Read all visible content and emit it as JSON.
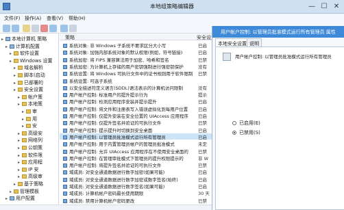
{
  "window": {
    "title": "本地组策略编辑器",
    "minimize": "—",
    "maximize": "☐",
    "close": "✕"
  },
  "menu": [
    {
      "label": "文件(F)"
    },
    {
      "label": "操作(A)"
    },
    {
      "label": "查看(V)"
    },
    {
      "label": "帮助(H)"
    }
  ],
  "tree": [
    {
      "label": "本地计算机 策略",
      "indent": 0,
      "icon": "computer-icon"
    },
    {
      "label": "计算机配置",
      "indent": 1,
      "icon": "computer-icon"
    },
    {
      "label": "软件设置",
      "indent": 2,
      "icon": "folder-icon"
    },
    {
      "label": "Windows 设置",
      "indent": 2,
      "icon": "folder-icon"
    },
    {
      "label": "域名解析",
      "indent": 3,
      "icon": "folder-icon"
    },
    {
      "label": "脚本(启动",
      "indent": 3,
      "icon": "folder-icon"
    },
    {
      "label": "已部署的",
      "indent": 3,
      "icon": "folder-icon"
    },
    {
      "label": "安全设置",
      "indent": 3,
      "icon": "folder-icon"
    },
    {
      "label": "帐户策",
      "indent": 4,
      "icon": "folder-icon"
    },
    {
      "label": "本地策",
      "indent": 4,
      "icon": "folder-icon"
    },
    {
      "label": "审",
      "indent": 5,
      "icon": "folder-icon"
    },
    {
      "label": "用",
      "indent": 5,
      "icon": "folder-icon"
    },
    {
      "label": "安",
      "indent": 5,
      "icon": "folder-icon"
    },
    {
      "label": "高级安",
      "indent": 4,
      "icon": "folder-icon"
    },
    {
      "label": "网络列",
      "indent": 4,
      "icon": "folder-icon"
    },
    {
      "label": "公钥策",
      "indent": 4,
      "icon": "folder-icon"
    },
    {
      "label": "软件限",
      "indent": 4,
      "icon": "folder-icon"
    },
    {
      "label": "应用程",
      "indent": 4,
      "icon": "folder-icon"
    },
    {
      "label": "IP 安",
      "indent": 4,
      "icon": "folder-icon"
    },
    {
      "label": "高级审",
      "indent": 4,
      "icon": "folder-icon"
    },
    {
      "label": "基于策略",
      "indent": 3,
      "icon": "folder-icon"
    },
    {
      "label": "管理模板",
      "indent": 2,
      "icon": "folder-icon"
    },
    {
      "label": "用户配置",
      "indent": 1,
      "icon": "user-icon"
    }
  ],
  "list": {
    "headers": {
      "policy": "策略",
      "setting": "安全设置"
    },
    "rows": [
      {
        "name": "系统对象: 非 Windows 子系统不要求区分大小写",
        "state": "已启"
      },
      {
        "name": "系统对象: 加强内部系统对象的默认权限(例如，符号链接)",
        "state": "已启"
      },
      {
        "name": "系统加密: 将 FIPS 兼容算法用于加密、哈希和签名",
        "state": "已禁"
      },
      {
        "name": "系统加密: 为计算机上存储的用户密钥强制进行强密钥保护",
        "state": "没有"
      },
      {
        "name": "系统设置: 将 Windows 可执行文件中的证书规则用于软件限制",
        "state": "已禁"
      },
      {
        "name": "系统设置: 可选子系统",
        "state": ""
      },
      {
        "name": "以安全描述符定义语言(SDDL)语法表示的计算机访问限制",
        "state": "没有"
      },
      {
        "name": "用户帐户控制: 标准用户的提升提示行为",
        "state": "提示"
      },
      {
        "name": "用户帐户控制: 检测应用程序安装并提示提升",
        "state": "已启"
      },
      {
        "name": "用户帐户控制: 将文件和注册表写入错误虚拟化到每用户位置",
        "state": "已启"
      },
      {
        "name": "用户帐户控制: 仅提升安装在安全位置的 UIAccess 应用程序",
        "state": "已启"
      },
      {
        "name": "用户帐户控制: 仅提升签名并验证的可执行文件",
        "state": "已禁"
      },
      {
        "name": "用户帐户控制: 提示提升时切换到安全桌面",
        "state": "已启"
      },
      {
        "name": "用户帐户控制: 以管理员批准模式运行所有管理员",
        "state": "已启",
        "selected": true
      },
      {
        "name": "用户帐户控制: 用于内置管理员帐户的管理员批准模式",
        "state": "未定"
      },
      {
        "name": "用户帐户控制: 允许 UIAccess 应用程序在不使用安全桌面的",
        "state": "已禁"
      },
      {
        "name": "用户帐户控制: 在管理审批模式下管理员的提升权限提示的",
        "state": "非 W"
      },
      {
        "name": "用户帐户控制: 将提升签名并验证的可执行文件",
        "state": "已禁"
      },
      {
        "name": "域成员: 对安全通道数据进行数字加密(如果可能)",
        "state": "已启"
      },
      {
        "name": "域成员: 对安全通道数据进行数字加密或数字签名(始终)",
        "state": "已启"
      },
      {
        "name": "域成员: 对安全通道数据进行数字签名(如果可能)",
        "state": "已启"
      },
      {
        "name": "域成员: 计算机帐户密码最长使用期限",
        "state": "30 天"
      },
      {
        "name": "域成员: 禁用计算机帐户密码更改",
        "state": "已禁"
      }
    ]
  },
  "dialog": {
    "title": "用户帐户控制: 以管理员批准模式运行所有管理员 属性",
    "tabs": [
      {
        "label": "本地安全设置",
        "active": true
      },
      {
        "label": "说明",
        "active": false
      }
    ],
    "policy_name": "用户帐户控制: 以管理员批准模式运行所有管理员",
    "options": [
      {
        "label": "已启用(E)",
        "checked": false
      },
      {
        "label": "已禁用(S)",
        "checked": true
      }
    ]
  },
  "colors": {
    "accent": "#3f8ad8",
    "selected_row": "#cce4f7",
    "titlebar": "#cfe0f1"
  }
}
